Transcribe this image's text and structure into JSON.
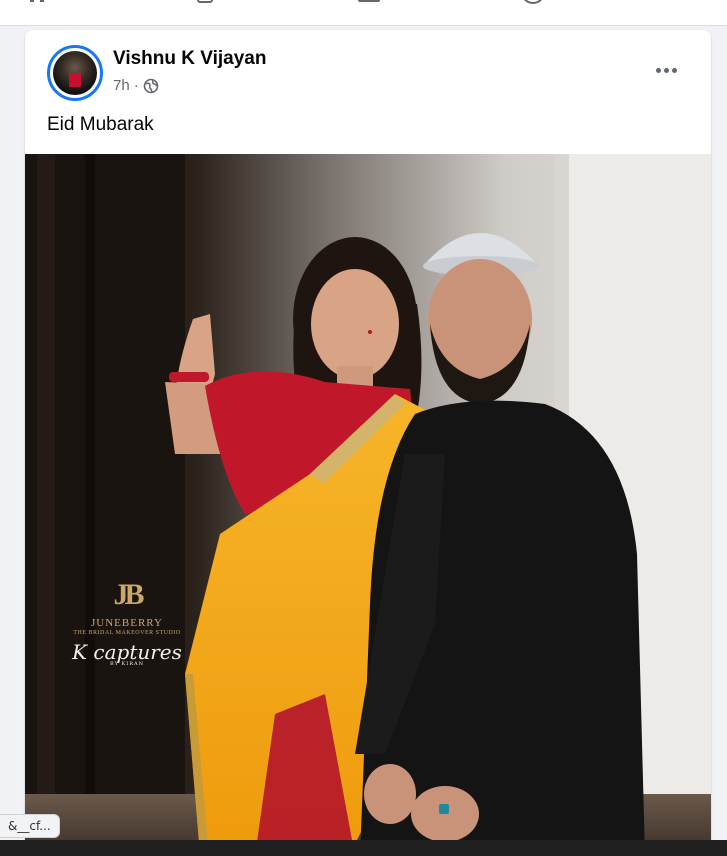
{
  "topnav": {
    "icons": [
      "home-icon",
      "watch-icon",
      "marketplace-icon",
      "groups-icon"
    ]
  },
  "post": {
    "author": "Vishnu K Vijayan",
    "time": "7h",
    "separator": "·",
    "audience_icon": "globe-icon",
    "more_icon": "more-options-icon",
    "caption": "Eid Mubarak",
    "photo": {
      "watermark_monogram": "JB",
      "watermark_brand": "JUNEBERRY",
      "watermark_tagline": "THE BRIDAL MAKEOVER STUDIO",
      "watermark_script": "K captures",
      "watermark_script_by": "BY KIRAN"
    }
  },
  "status_url": "&__cf...",
  "colors": {
    "story_ring": "#1877f2",
    "saree_yellow": "#f5a514",
    "blouse_red": "#c0182a",
    "kurta_black": "#141414"
  }
}
